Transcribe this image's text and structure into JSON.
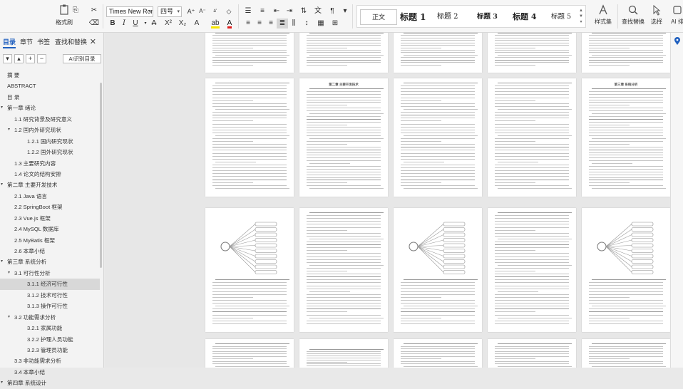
{
  "ribbon": {
    "format_painter": "格式刷",
    "font_name": "Times New Roma",
    "font_size": "四号",
    "style_gallery": [
      "正文",
      "标题 1",
      "标题 2",
      "标题 3",
      "标题 4",
      "标题 5"
    ],
    "style_set": "样式集",
    "find_replace": "查找替换",
    "select": "选择",
    "ai": "AI 排",
    "colors": {
      "font_color": "#e01b1b",
      "highlight": "#f7e600",
      "accent": "#1f5fbf"
    }
  },
  "nav": {
    "tabs": [
      "目录",
      "章节",
      "书签",
      "查找和替换"
    ],
    "ai_toc": "AI识别目录",
    "items": [
      {
        "label": "摘 要",
        "level": 0,
        "toggle": ""
      },
      {
        "label": "ABSTRACT",
        "level": 0,
        "toggle": ""
      },
      {
        "label": "目 录",
        "level": 0,
        "toggle": ""
      },
      {
        "label": "第一章 绪论",
        "level": 0,
        "toggle": "▾"
      },
      {
        "label": "1.1 研究背景及研究意义",
        "level": 1,
        "toggle": ""
      },
      {
        "label": "1.2 国内外研究现状",
        "level": 1,
        "toggle": "▾"
      },
      {
        "label": "1.2.1 国内研究现状",
        "level": 2,
        "toggle": ""
      },
      {
        "label": "1.2.2 国外研究现状",
        "level": 2,
        "toggle": ""
      },
      {
        "label": "1.3 主要研究内容",
        "level": 1,
        "toggle": ""
      },
      {
        "label": "1.4 论文的结构安排",
        "level": 1,
        "toggle": ""
      },
      {
        "label": "第二章 主要开发技术",
        "level": 0,
        "toggle": "▾"
      },
      {
        "label": "2.1 Java 语言",
        "level": 1,
        "toggle": ""
      },
      {
        "label": "2.2 SpringBoot 框架",
        "level": 1,
        "toggle": ""
      },
      {
        "label": "2.3 Vue.js 框架",
        "level": 1,
        "toggle": ""
      },
      {
        "label": "2.4 MySQL 数据库",
        "level": 1,
        "toggle": ""
      },
      {
        "label": "2.5 MyBatis 框架",
        "level": 1,
        "toggle": ""
      },
      {
        "label": "2.6 本章小结",
        "level": 1,
        "toggle": ""
      },
      {
        "label": "第三章 系统分析",
        "level": 0,
        "toggle": "▾"
      },
      {
        "label": "3.1 可行性分析",
        "level": 1,
        "toggle": "▾"
      },
      {
        "label": "3.1.1 经济可行性",
        "level": 2,
        "toggle": "",
        "selected": true
      },
      {
        "label": "3.1.2 技术可行性",
        "level": 2,
        "toggle": ""
      },
      {
        "label": "3.1.3 操作可行性",
        "level": 2,
        "toggle": ""
      },
      {
        "label": "3.2 功能需求分析",
        "level": 1,
        "toggle": "▾"
      },
      {
        "label": "3.2.1 家属功能",
        "level": 2,
        "toggle": ""
      },
      {
        "label": "3.2.2 护理人员功能",
        "level": 2,
        "toggle": ""
      },
      {
        "label": "3.2.3 管理员功能",
        "level": 2,
        "toggle": ""
      },
      {
        "label": "3.3 非功能需求分析",
        "level": 1,
        "toggle": ""
      },
      {
        "label": "3.4 本章小结",
        "level": 1,
        "toggle": ""
      },
      {
        "label": "第四章 系统设计",
        "level": 0,
        "toggle": "▾"
      }
    ]
  },
  "pages": {
    "row2": [
      {
        "heading": "",
        "text_lines": 36
      },
      {
        "heading": "",
        "text_lines": 34
      },
      {
        "heading": "第二章 主要开发技术",
        "text_lines": 38
      },
      {
        "heading": "",
        "text_lines": 40
      },
      {
        "heading": "",
        "text_lines": 32
      },
      {
        "heading": "第三章 系统分析",
        "text_lines": 38
      }
    ]
  }
}
